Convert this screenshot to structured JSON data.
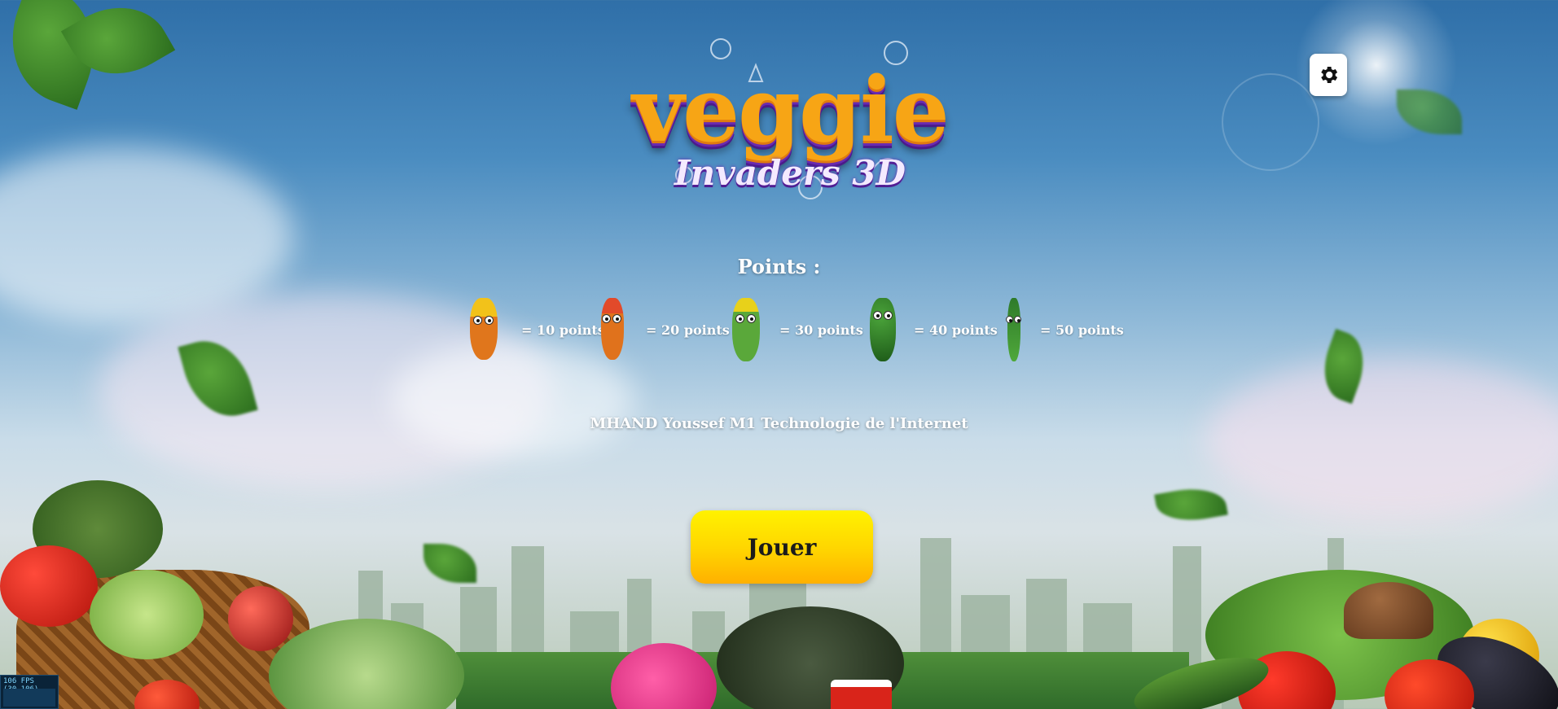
{
  "game": {
    "logo_title": "veggie",
    "logo_subtitle": "Invaders 3D"
  },
  "settings": {
    "icon": "gear-icon"
  },
  "points": {
    "title": "Points :",
    "items": [
      {
        "enemy": "carrot-with-helmet",
        "label": "= 10 points"
      },
      {
        "enemy": "carrot-with-cap",
        "label": "= 20 points"
      },
      {
        "enemy": "celery-with-cap",
        "label": "= 30 points"
      },
      {
        "enemy": "cucumber",
        "label": "= 40 points"
      },
      {
        "enemy": "asparagus",
        "label": "= 50 points"
      }
    ]
  },
  "credits": "MHAND Youssef M1 Technologie de l'Internet",
  "play_button": {
    "label": "Jouer"
  },
  "fps_meter": {
    "text": "106 FPS (30-106)"
  },
  "colors": {
    "play_button_top": "#fff200",
    "play_button_bottom": "#ffb000",
    "logo_orange": "#f7a515",
    "logo_purple": "#6a2ab0",
    "sky_top": "#2f6fa8"
  }
}
